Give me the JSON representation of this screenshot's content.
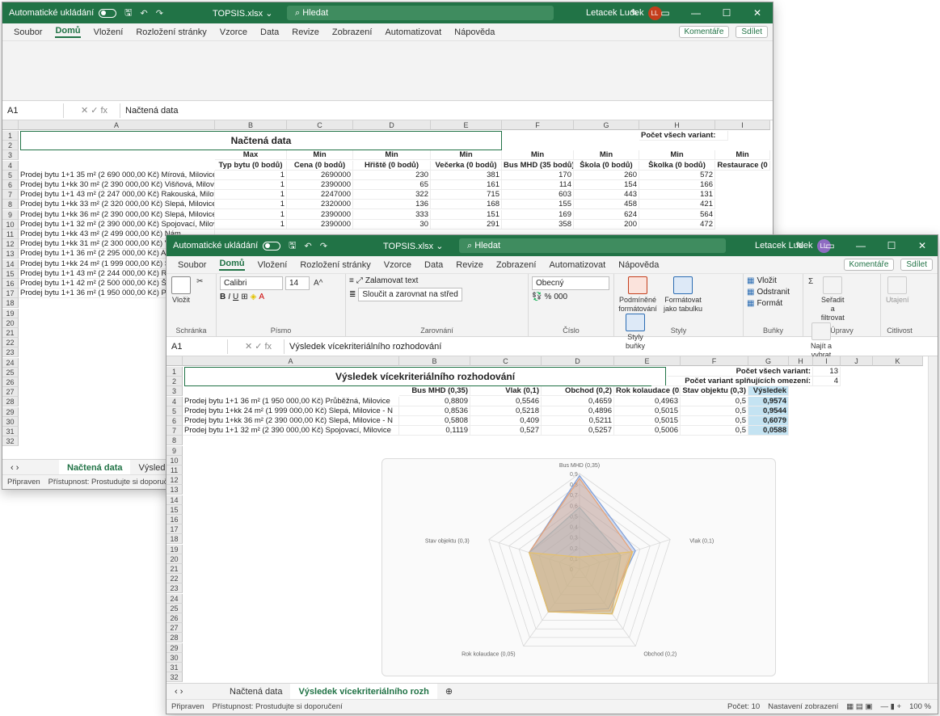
{
  "window1": {
    "autosave_label": "Automatické ukládání",
    "file_name": "TOPSIS.xlsx ⌄",
    "search_placeholder": "Hledat",
    "user_name": "Letacek Ludek",
    "user_initials": "LL",
    "menu": [
      "Soubor",
      "Domů",
      "Vložení",
      "Rozložení stránky",
      "Vzorce",
      "Data",
      "Revize",
      "Zobrazení",
      "Automatizovat",
      "Nápověda"
    ],
    "comments": "Komentáře",
    "share": "Sdílet",
    "name_box": "A1",
    "formula": "Načtená data",
    "col_headers": [
      "A",
      "B",
      "C",
      "D",
      "E",
      "F",
      "G",
      "H",
      "I"
    ],
    "title": "Načtená data",
    "count_label": "Počet všech variant:",
    "row3": [
      "Max",
      "Min",
      "Min",
      "Min",
      "Min",
      "Min",
      "Min",
      "Min"
    ],
    "row4": [
      "Typ bytu (0 bodů)",
      "Cena (0 bodů)",
      "Hřiště (0 bodů)",
      "Večerka (0 bodů)",
      "Bus MHD (35 bodů)",
      "Škola (0 bodů)",
      "Školka (0 bodů)",
      "Restaurace (0"
    ],
    "rows": [
      {
        "n": "5",
        "a": "Prodej bytu 1+1 35 m² (2 690 000,00 Kč) Mírová, Milovicehtt",
        "v": [
          "1",
          "2690000",
          "230",
          "381",
          "170",
          "260",
          "572"
        ]
      },
      {
        "n": "6",
        "a": "Prodej bytu 1+kk 30 m² (2 390 000,00 Kč) Višňová, Milovice",
        "v": [
          "1",
          "2390000",
          "65",
          "161",
          "114",
          "154",
          "166"
        ]
      },
      {
        "n": "7",
        "a": "Prodej bytu 1+1 43 m² (2 247 000,00 Kč) Rakouská, Milovice",
        "v": [
          "1",
          "2247000",
          "322",
          "715",
          "603",
          "443",
          "131"
        ]
      },
      {
        "n": "8",
        "a": "Prodej bytu 1+kk 33 m² (2 320 000,00 Kč) Slepá, Milovice - N",
        "v": [
          "1",
          "2320000",
          "136",
          "168",
          "155",
          "458",
          "421"
        ]
      },
      {
        "n": "9",
        "a": "Prodej bytu 1+kk 36 m² (2 390 000,00 Kč) Slepá, Milovice - N",
        "v": [
          "1",
          "2390000",
          "333",
          "151",
          "169",
          "624",
          "564"
        ]
      },
      {
        "n": "10",
        "a": "Prodej bytu 1+1 32 m² (2 390 000,00 Kč) Spojovací, Milovice",
        "v": [
          "1",
          "2390000",
          "30",
          "291",
          "358",
          "200",
          "472"
        ]
      },
      {
        "n": "11",
        "a": "Prodej bytu 1+kk 43 m² (2 499 000,00 Kč) Nám",
        "v": []
      },
      {
        "n": "12",
        "a": "Prodej bytu 1+kk 31 m² (2 300 000,00 Kč) Višň",
        "v": []
      },
      {
        "n": "13",
        "a": "Prodej bytu 1+1 36 m² (2 295 000,00 Kč) Armá",
        "v": []
      },
      {
        "n": "14",
        "a": "Prodej bytu 1+kk 24 m² (1 999 000,00 Kč) Slep",
        "v": []
      },
      {
        "n": "15",
        "a": "Prodej bytu 1+1 43 m² (2 244 000,00 Kč) Rako",
        "v": []
      },
      {
        "n": "16",
        "a": "Prodej bytu 1+1 42 m² (2 500 000,00 Kč) Školsk",
        "v": []
      },
      {
        "n": "17",
        "a": "Prodej bytu 1+1 36 m² (1 950 000,00 Kč) Průbě",
        "v": []
      }
    ],
    "empty_rows": [
      "18",
      "19",
      "20",
      "21",
      "22",
      "23",
      "24",
      "25",
      "26",
      "27",
      "28",
      "29",
      "30",
      "31",
      "32"
    ],
    "tabs": [
      "Načtená data",
      "Výsledek více"
    ],
    "status": "Připraven",
    "accessibility": "Přístupnost: Prostudujte si doporučení"
  },
  "window2": {
    "autosave_label": "Automatické ukládání",
    "file_name": "TOPSIS.xlsx ⌄",
    "search_placeholder": "Hledat",
    "user_name": "Letacek Ludek",
    "user_initials": "LL",
    "menu": [
      "Soubor",
      "Domů",
      "Vložení",
      "Rozložení stránky",
      "Vzorce",
      "Data",
      "Revize",
      "Zobrazení",
      "Automatizovat",
      "Nápověda"
    ],
    "comments": "Komentáře",
    "share": "Sdílet",
    "ribbon": {
      "font": "Calibri",
      "size": "14",
      "wrap": "Zalamovat text",
      "merge": "Sloučit a zarovnat na střed",
      "numfmt": "Obecný",
      "cond": "Podmíněné formátování",
      "astable": "Formátovat jako tabulku",
      "styles": "Styly buňky",
      "insert": "Vložit",
      "delete": "Odstranit",
      "format": "Formát",
      "sort": "Seřadit a filtrovat",
      "find": "Najít a vybrat",
      "sens": "Utajení",
      "groups": [
        "Schránka",
        "Písmo",
        "Zarovnání",
        "Číslo",
        "Styly",
        "Buňky",
        "Úpravy",
        "Citlivost"
      ],
      "paste": "Vložit"
    },
    "name_box": "A1",
    "formula": "Výsledek vícekriteriálního rozhodování",
    "col_headers": [
      "A",
      "B",
      "C",
      "D",
      "E",
      "F",
      "G",
      "H",
      "I",
      "J",
      "K"
    ],
    "title": "Výsledek vícekriteriálního rozhodování",
    "count_all_label": "Počet všech variant:",
    "count_all": "13",
    "count_ok_label": "Počet variant splňujících omezení:",
    "count_ok": "4",
    "headers": [
      "Bus MHD (0,35)",
      "Vlak (0,1)",
      "Obchod (0,2)",
      "Rok kolaudace (0,05)",
      "Stav objektu (0,3)",
      "Výsledek"
    ],
    "rows": [
      {
        "n": "4",
        "a": "Prodej bytu 1+1 36 m² (1 950 000,00 Kč) Průběžná, Milovice",
        "v": [
          "0,8809",
          "0,5546",
          "0,4659",
          "0,4963",
          "0,5",
          "0,9574"
        ]
      },
      {
        "n": "5",
        "a": "Prodej bytu 1+kk 24 m² (1 999 000,00 Kč) Slepá, Milovice - N",
        "v": [
          "0,8536",
          "0,5218",
          "0,4896",
          "0,5015",
          "0,5",
          "0,9544"
        ]
      },
      {
        "n": "6",
        "a": "Prodej bytu 1+kk 36 m² (2 390 000,00 Kč) Slepá, Milovice - N",
        "v": [
          "0,5808",
          "0,409",
          "0,5211",
          "0,5015",
          "0,5",
          "0,6079"
        ]
      },
      {
        "n": "7",
        "a": "Prodej bytu 1+1 32 m² (2 390 000,00 Kč) Spojovací, Milovice",
        "v": [
          "0,1119",
          "0,527",
          "0,5257",
          "0,5006",
          "0,5",
          "0,0588"
        ]
      }
    ],
    "tabs": [
      "Načtená data",
      "Výsledek vícekriteriálního rozh"
    ],
    "status": "Připraven",
    "accessibility": "Přístupnost: Prostudujte si doporučení",
    "status_count": "Počet: 10",
    "view_settings": "Nastavení zobrazení",
    "zoom": "100 %"
  },
  "chart_data": {
    "type": "radar",
    "categories": [
      "Bus MHD (0,35)",
      "Vlak (0,1)",
      "Obchod (0,2)",
      "Rok kolaudace (0,05)",
      "Stav objektu (0,3)"
    ],
    "ticks": [
      "0,9",
      "0,8",
      "0,7",
      "0,6",
      "0,5",
      "0,4",
      "0,3",
      "0,2",
      "0,1",
      "0"
    ],
    "rmax": 0.9,
    "series": [
      {
        "values": [
          0.8809,
          0.5546,
          0.4659,
          0.4963,
          0.5
        ],
        "color": "#7f9fd9"
      },
      {
        "values": [
          0.8536,
          0.5218,
          0.4896,
          0.5015,
          0.5
        ],
        "color": "#e8a274"
      },
      {
        "values": [
          0.5808,
          0.409,
          0.5211,
          0.5015,
          0.5
        ],
        "color": "#b0b0b0"
      },
      {
        "values": [
          0.1119,
          0.527,
          0.5257,
          0.5006,
          0.5
        ],
        "color": "#e6c069"
      }
    ]
  },
  "colors": {
    "excel_green": "#217346",
    "result_fill": "#c4e3f2",
    "avatar": "#c43e1c"
  }
}
